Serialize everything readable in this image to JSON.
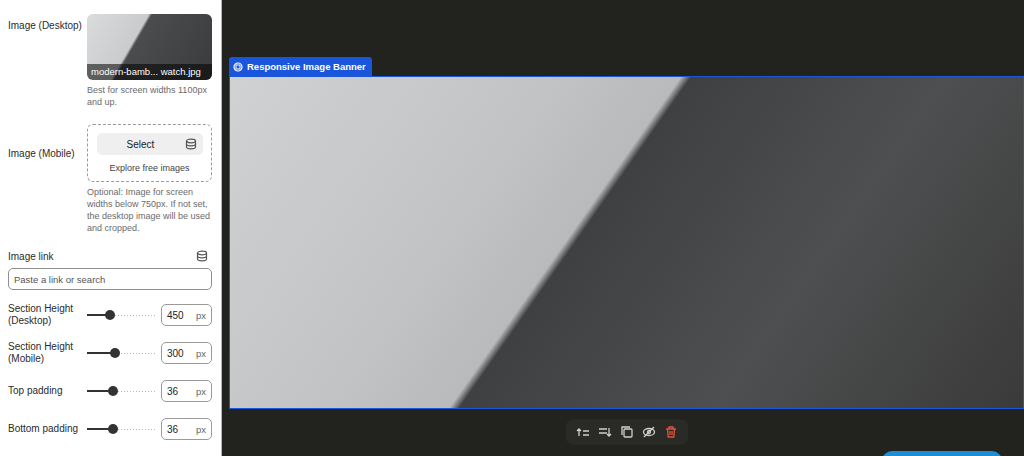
{
  "sidebar": {
    "desktop_image": {
      "label": "Image (Desktop)",
      "filename": "modern-bamb... watch.jpg",
      "help": "Best for screen widths 1100px and up."
    },
    "mobile_image": {
      "label": "Image (Mobile)",
      "button": "Select",
      "explore": "Explore free images",
      "help": "Optional: Image for screen widths below 750px. If not set, the desktop image will be used and cropped."
    },
    "image_link": {
      "label": "Image link",
      "placeholder": "Paste a link or search"
    },
    "sliders": [
      {
        "label": "Section Height (Desktop)",
        "value": "450",
        "unit": "px",
        "level": 0.34
      },
      {
        "label": "Section Height (Mobile)",
        "value": "300",
        "unit": "px",
        "level": 0.41
      },
      {
        "label": "Top padding",
        "value": "36",
        "unit": "px",
        "level": 0.38
      },
      {
        "label": "Bottom padding",
        "value": "36",
        "unit": "px",
        "level": 0.38
      }
    ]
  },
  "canvas": {
    "section_label": "Responsive Image Banner"
  }
}
